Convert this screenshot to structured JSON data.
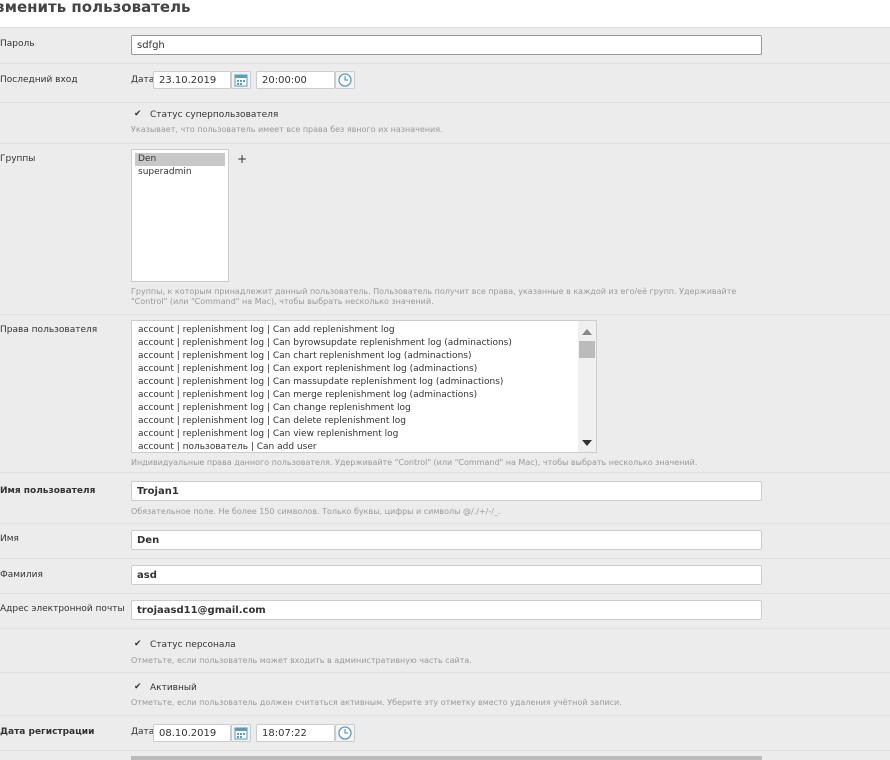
{
  "page": {
    "title": "зменить пользователь"
  },
  "password": {
    "label": "Пароль",
    "value": "sdfgh"
  },
  "last_login": {
    "label": "Последний вход",
    "date_label": "Дата",
    "date": "23.10.2019",
    "time": "20:00:00"
  },
  "superuser": {
    "label": "Статус суперпользователя",
    "help": "Указывает, что пользователь имеет все права без явного их назначения.",
    "checked": true
  },
  "groups": {
    "label": "Группы",
    "items": [
      "Den",
      "superadmin"
    ],
    "selected": "Den",
    "help_1": "Группы, к которым принадлежит данный пользователь. Пользователь получит все права, указанные в каждой из его/её групп. Удерживайте",
    "help_2": "\"Control\" (или \"Command\" на Mac), чтобы выбрать несколько значений."
  },
  "permissions": {
    "label": "Права пользователя",
    "items": [
      "account | replenishment log | Can add replenishment log",
      "account | replenishment log | Can byrowsupdate replenishment log (adminactions)",
      "account | replenishment log | Can chart replenishment log (adminactions)",
      "account | replenishment log | Can export replenishment log (adminactions)",
      "account | replenishment log | Can massupdate replenishment log (adminactions)",
      "account | replenishment log | Can merge replenishment log (adminactions)",
      "account | replenishment log | Can change replenishment log",
      "account | replenishment log | Can delete replenishment log",
      "account | replenishment log | Can view replenishment log",
      "account | пользователь | Can add user"
    ],
    "help": "Индивидуальные права данного пользователя. Удерживайте \"Control\" (или \"Command\" на Mac), чтобы выбрать несколько значений."
  },
  "username": {
    "label": "Имя пользователя",
    "value": "Trojan1",
    "help": "Обязательное поле. Не более 150 символов. Только буквы, цифры и символы @/./+/-/_."
  },
  "first_name": {
    "label": "Имя",
    "value": "Den"
  },
  "last_name": {
    "label": "Фамилия",
    "value": "asd"
  },
  "email": {
    "label": "Адрес электронной почты",
    "value": "trojaasd11@gmail.com"
  },
  "staff": {
    "label": "Статус персонала",
    "help": "Отметьте, если пользователь может входить в административную часть сайта.",
    "checked": true
  },
  "active": {
    "label": "Активный",
    "help": "Отметьте, если пользователь должен считаться активным. Уберите эту отметку вместо удаления учётной записи.",
    "checked": true
  },
  "date_joined": {
    "label": "Дата регистрации",
    "date_label": "Дата",
    "date": "08.10.2019",
    "time": "18:07:22"
  },
  "icons": {
    "calendar": "calendar-icon",
    "clock": "clock-icon",
    "checkmark": "✔",
    "plus": "+"
  },
  "colors": {
    "accent": "#79aec8",
    "background": "#ececec"
  }
}
